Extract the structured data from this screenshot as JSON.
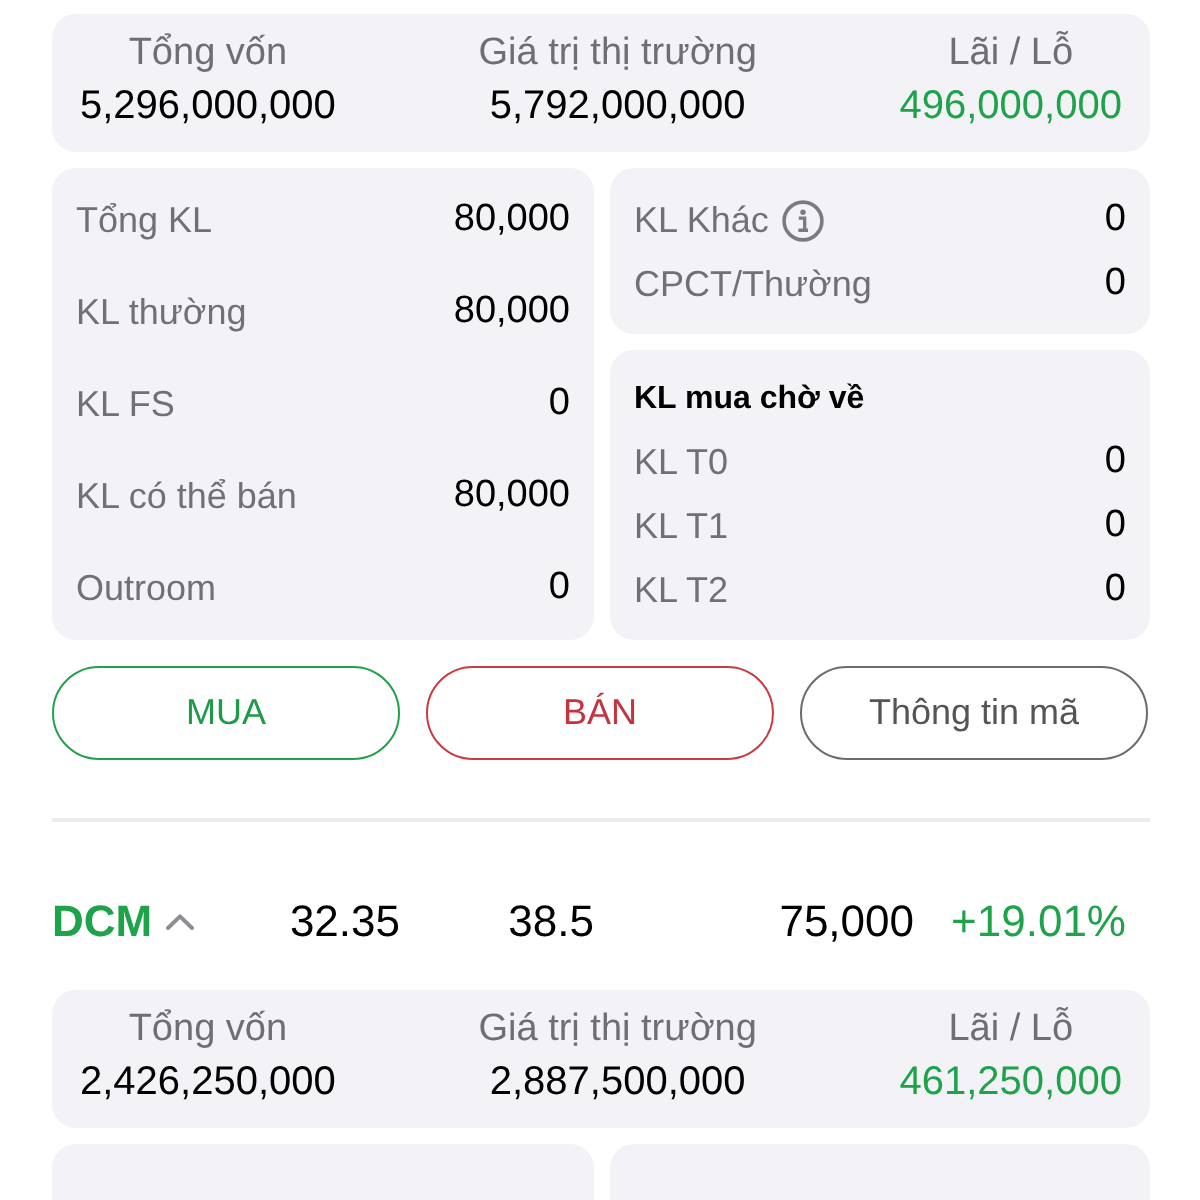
{
  "positions": [
    {
      "summary": [
        {
          "label": "Tổng vốn",
          "value": "5,296,000,000",
          "kind": "plain"
        },
        {
          "label": "Giá trị thị trường",
          "value": "5,792,000,000",
          "kind": "plain"
        },
        {
          "label": "Lãi / Lỗ",
          "value": "496,000,000",
          "kind": "gain"
        }
      ],
      "holdings": [
        {
          "label": "Tổng KL",
          "value": "80,000"
        },
        {
          "label": "KL thường",
          "value": "80,000"
        },
        {
          "label": "KL FS",
          "value": "0"
        },
        {
          "label": "KL có thể bán",
          "value": "80,000"
        },
        {
          "label": "Outroom",
          "value": "0"
        }
      ],
      "other": [
        {
          "label": "KL Khác",
          "info": true,
          "value": "0"
        },
        {
          "label": "CPCT/Thường",
          "info": false,
          "value": "0"
        }
      ],
      "pending": {
        "title": "KL mua chờ về",
        "rows": [
          {
            "label": "KL T0",
            "value": "0"
          },
          {
            "label": "KL T1",
            "value": "0"
          },
          {
            "label": "KL T2",
            "value": "0"
          }
        ]
      },
      "actions": [
        {
          "label": "MUA",
          "kind": "buy"
        },
        {
          "label": "BÁN",
          "kind": "sell"
        },
        {
          "label": "Thông tin mã",
          "kind": "info"
        }
      ]
    },
    {
      "header": {
        "symbol": "DCM",
        "kind": "gain",
        "expanded": true,
        "cells": [
          {
            "text": "32.35",
            "kind": "plain"
          },
          {
            "text": "38.5",
            "kind": "plain"
          },
          {
            "text": "75,000",
            "kind": "plain"
          },
          {
            "text": "+19.01%",
            "kind": "gain"
          }
        ]
      },
      "summary": [
        {
          "label": "Tổng vốn",
          "value": "2,426,250,000",
          "kind": "plain"
        },
        {
          "label": "Giá trị thị trường",
          "value": "2,887,500,000",
          "kind": "plain"
        },
        {
          "label": "Lãi / Lỗ",
          "value": "461,250,000",
          "kind": "gain"
        }
      ]
    }
  ]
}
